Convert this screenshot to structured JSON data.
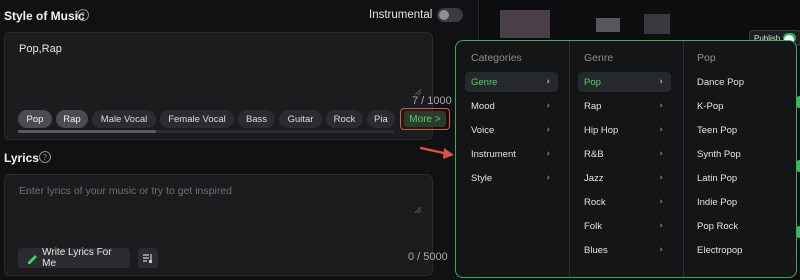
{
  "style_section": {
    "title": "Style of Music",
    "help_icon": "?",
    "instrumental_label": "Instrumental",
    "instrumental_on": false,
    "text_value": "Pop,Rap",
    "char_count": "7 / 1000",
    "chips": [
      {
        "label": "Pop",
        "selected": true
      },
      {
        "label": "Rap",
        "selected": true
      },
      {
        "label": "Male Vocal",
        "selected": false
      },
      {
        "label": "Female Vocal",
        "selected": false
      },
      {
        "label": "Bass",
        "selected": false
      },
      {
        "label": "Guitar",
        "selected": false
      },
      {
        "label": "Rock",
        "selected": false
      },
      {
        "label": "Pia",
        "selected": false
      }
    ],
    "more_label": "More >"
  },
  "lyrics_section": {
    "title": "Lyrics",
    "help_icon": "?",
    "placeholder": "Enter lyrics of your music or try to get inspired",
    "write_button": "Write Lyrics For Me",
    "char_count": "0 / 5000"
  },
  "dropdown": {
    "columns": [
      {
        "header": "Categories",
        "items": [
          {
            "label": "Genre",
            "active": true,
            "chevron": true
          },
          {
            "label": "Mood",
            "active": false,
            "chevron": true
          },
          {
            "label": "Voice",
            "active": false,
            "chevron": true
          },
          {
            "label": "Instrument",
            "active": false,
            "chevron": true
          },
          {
            "label": "Style",
            "active": false,
            "chevron": true
          }
        ]
      },
      {
        "header": "Genre",
        "items": [
          {
            "label": "Pop",
            "active": true,
            "chevron": true
          },
          {
            "label": "Rap",
            "active": false,
            "chevron": true
          },
          {
            "label": "Hip Hop",
            "active": false,
            "chevron": true
          },
          {
            "label": "R&B",
            "active": false,
            "chevron": true
          },
          {
            "label": "Jazz",
            "active": false,
            "chevron": true
          },
          {
            "label": "Rock",
            "active": false,
            "chevron": true
          },
          {
            "label": "Folk",
            "active": false,
            "chevron": true
          },
          {
            "label": "Blues",
            "active": false,
            "chevron": true
          }
        ]
      },
      {
        "header": "Pop",
        "items": [
          {
            "label": "Dance Pop",
            "active": false,
            "chevron": false
          },
          {
            "label": "K-Pop",
            "active": false,
            "chevron": false
          },
          {
            "label": "Teen Pop",
            "active": false,
            "chevron": false
          },
          {
            "label": "Synth Pop",
            "active": false,
            "chevron": false
          },
          {
            "label": "Latin Pop",
            "active": false,
            "chevron": false
          },
          {
            "label": "Indie Pop",
            "active": false,
            "chevron": false
          },
          {
            "label": "Pop Rock",
            "active": false,
            "chevron": false
          },
          {
            "label": "Electropop",
            "active": false,
            "chevron": false
          }
        ]
      }
    ]
  },
  "right_panel": {
    "publish_label": "Publish",
    "publish_on": true
  },
  "colors": {
    "accent_green": "#48d264",
    "annotation_red": "#e0523b"
  }
}
